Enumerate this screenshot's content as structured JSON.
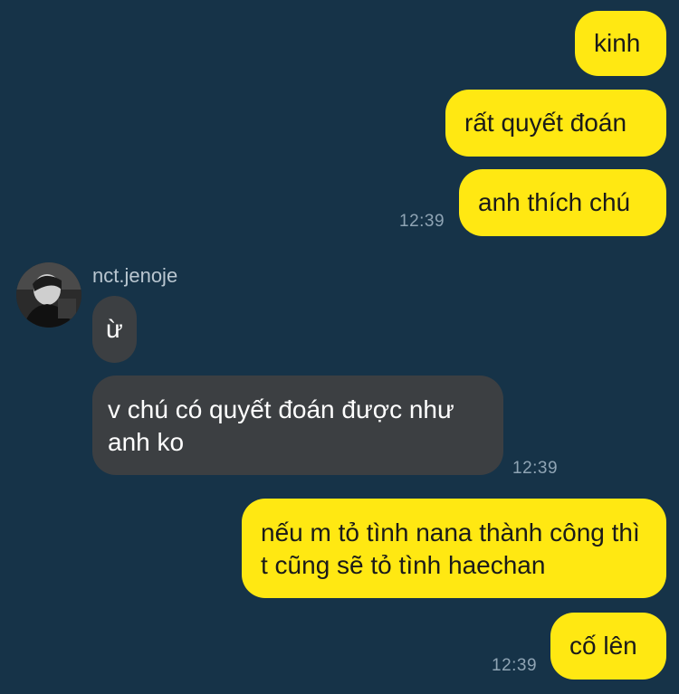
{
  "messages": [
    {
      "id": "m1",
      "direction": "outgoing",
      "text": "kinh"
    },
    {
      "id": "m2",
      "direction": "outgoing",
      "text": "rất quyết đoán"
    },
    {
      "id": "m3",
      "direction": "outgoing",
      "text": "anh thích chú",
      "time": "12:39"
    },
    {
      "id": "m4",
      "direction": "incoming",
      "sender": "nct.jenoje",
      "text": "ừ"
    },
    {
      "id": "m5",
      "direction": "incoming",
      "text": "v chú có quyết đoán được như anh ko",
      "time": "12:39"
    },
    {
      "id": "m6",
      "direction": "outgoing",
      "text": "nếu m tỏ tình nana thành công thì t cũng sẽ tỏ tình haechan"
    },
    {
      "id": "m7",
      "direction": "outgoing",
      "text": "cố lên",
      "time": "12:39"
    }
  ],
  "incoming_sender": "nct.jenoje",
  "colors": {
    "background": "#163348",
    "outgoing_bubble": "#FFE812",
    "incoming_bubble": "#3c3f42",
    "timestamp": "#8fa4b4"
  }
}
